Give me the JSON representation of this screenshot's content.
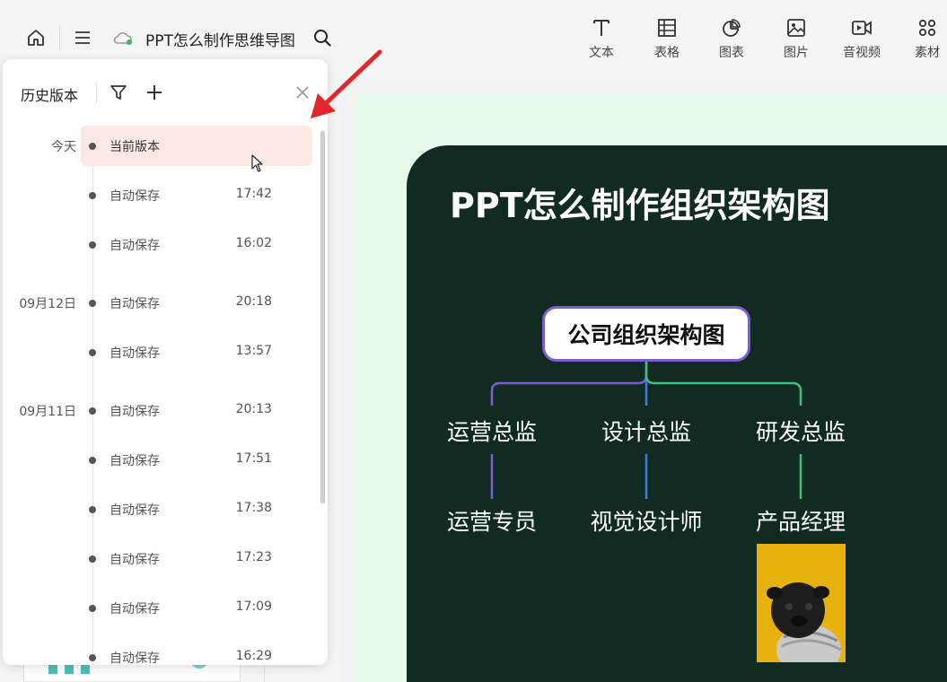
{
  "header": {
    "doc_title": "PPT怎么制作思维导图",
    "tools": [
      {
        "label": "文本",
        "icon": "text-icon"
      },
      {
        "label": "表格",
        "icon": "table-icon"
      },
      {
        "label": "图表",
        "icon": "chart-icon"
      },
      {
        "label": "图片",
        "icon": "image-icon"
      },
      {
        "label": "音视频",
        "icon": "video-icon"
      },
      {
        "label": "素材",
        "icon": "assets-icon"
      }
    ]
  },
  "history_panel": {
    "title": "历史版本",
    "entries": [
      {
        "date": "今天",
        "label": "当前版本",
        "time": "",
        "active": true
      },
      {
        "date": "",
        "label": "自动保存",
        "time": "17:42"
      },
      {
        "date": "",
        "label": "自动保存",
        "time": "16:02"
      },
      {
        "date": "09月12日",
        "label": "自动保存",
        "time": "20:18"
      },
      {
        "date": "",
        "label": "自动保存",
        "time": "13:57"
      },
      {
        "date": "09月11日",
        "label": "自动保存",
        "time": "20:13"
      },
      {
        "date": "",
        "label": "自动保存",
        "time": "17:51"
      },
      {
        "date": "",
        "label": "自动保存",
        "time": "17:38"
      },
      {
        "date": "",
        "label": "自动保存",
        "time": "17:23"
      },
      {
        "date": "",
        "label": "自动保存",
        "time": "17:09"
      },
      {
        "date": "",
        "label": "自动保存",
        "time": "16:29"
      }
    ]
  },
  "slide": {
    "title": "PPT怎么制作组织架构图",
    "root": "公司组织架构图",
    "level1": [
      "运营总监",
      "设计总监",
      "研发总监"
    ],
    "level2": [
      "运营专员",
      "视觉设计师",
      "产品经理"
    ]
  },
  "colors": {
    "slide_bg": "#112b23",
    "branch_purple": "#7b5ed6",
    "branch_blue": "#3f7be0",
    "branch_green": "#3fc07a",
    "highlight": "#fde9e4",
    "arrow": "#e3262b"
  }
}
